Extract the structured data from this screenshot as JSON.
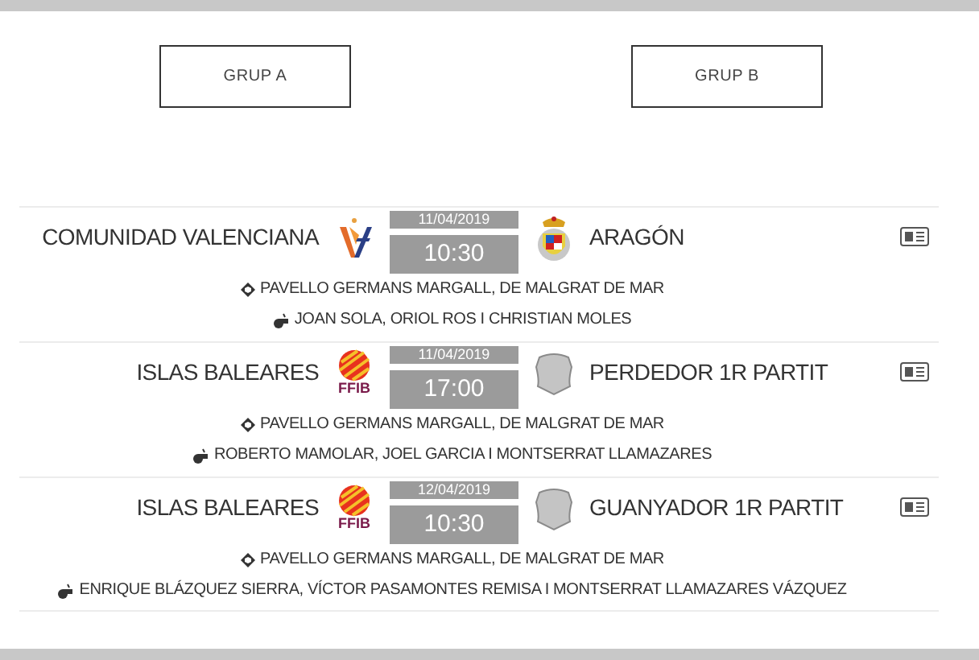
{
  "groups": [
    {
      "label": "GRUP A"
    },
    {
      "label": "GRUP B"
    }
  ],
  "matches": [
    {
      "home": {
        "name": "COMUNIDAD VALENCIANA",
        "logo": {
          "kind": "fbcv"
        }
      },
      "date": "11/04/2019",
      "time": "10:30",
      "away": {
        "name": "ARAGÓN",
        "logo": {
          "kind": "crest"
        }
      },
      "venue": "PAVELLO GERMANS MARGALL, DE MALGRAT DE MAR",
      "referees": "JOAN SOLA, ORIOL ROS I CHRISTIAN MOLES"
    },
    {
      "home": {
        "name": "ISLAS BALEARES",
        "logo": {
          "kind": "ffib",
          "text": "FFIB"
        }
      },
      "date": "11/04/2019",
      "time": "17:00",
      "away": {
        "name": "PERDEDOR 1R PARTIT",
        "logo": {
          "kind": "shield"
        }
      },
      "venue": "PAVELLO GERMANS MARGALL, DE MALGRAT DE MAR",
      "referees": "ROBERTO MAMOLAR, JOEL GARCIA I MONTSERRAT LLAMAZARES"
    },
    {
      "home": {
        "name": "ISLAS BALEARES",
        "logo": {
          "kind": "ffib",
          "text": "FFIB"
        }
      },
      "date": "12/04/2019",
      "time": "10:30",
      "away": {
        "name": "GUANYADOR 1R PARTIT",
        "logo": {
          "kind": "shield"
        }
      },
      "venue": "PAVELLO GERMANS MARGALL, DE MALGRAT DE MAR",
      "referees": "ENRIQUE BLÁZQUEZ SIERRA, VÍCTOR PASAMONTES REMISA I MONTSERRAT LLAMAZARES VÁZQUEZ"
    }
  ]
}
